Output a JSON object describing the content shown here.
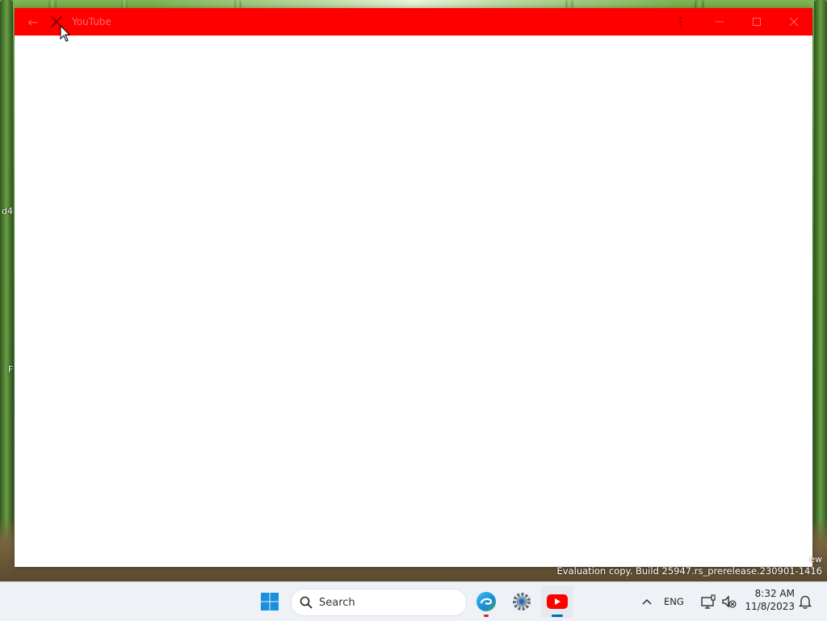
{
  "window": {
    "title": "YouTube",
    "titlebar_color": "#ff0000",
    "icons": {
      "back": "arrow-left-icon",
      "close_app": "close-icon",
      "more": "more-vertical-icon",
      "minimize": "minimize-icon",
      "maximize": "maximize-icon",
      "close": "close-icon"
    }
  },
  "desktop": {
    "icon_labels": [
      "d4",
      "F"
    ]
  },
  "watermark": {
    "line1": "ew",
    "line2": "Evaluation copy. Build 25947.rs_prerelease.230901-1416"
  },
  "taskbar": {
    "search_placeholder": "Search",
    "apps": [
      "start-icon",
      "edge-icon",
      "settings-icon",
      "youtube-icon"
    ],
    "language": "ENG",
    "time": "8:32 AM",
    "date": "11/8/2023"
  }
}
